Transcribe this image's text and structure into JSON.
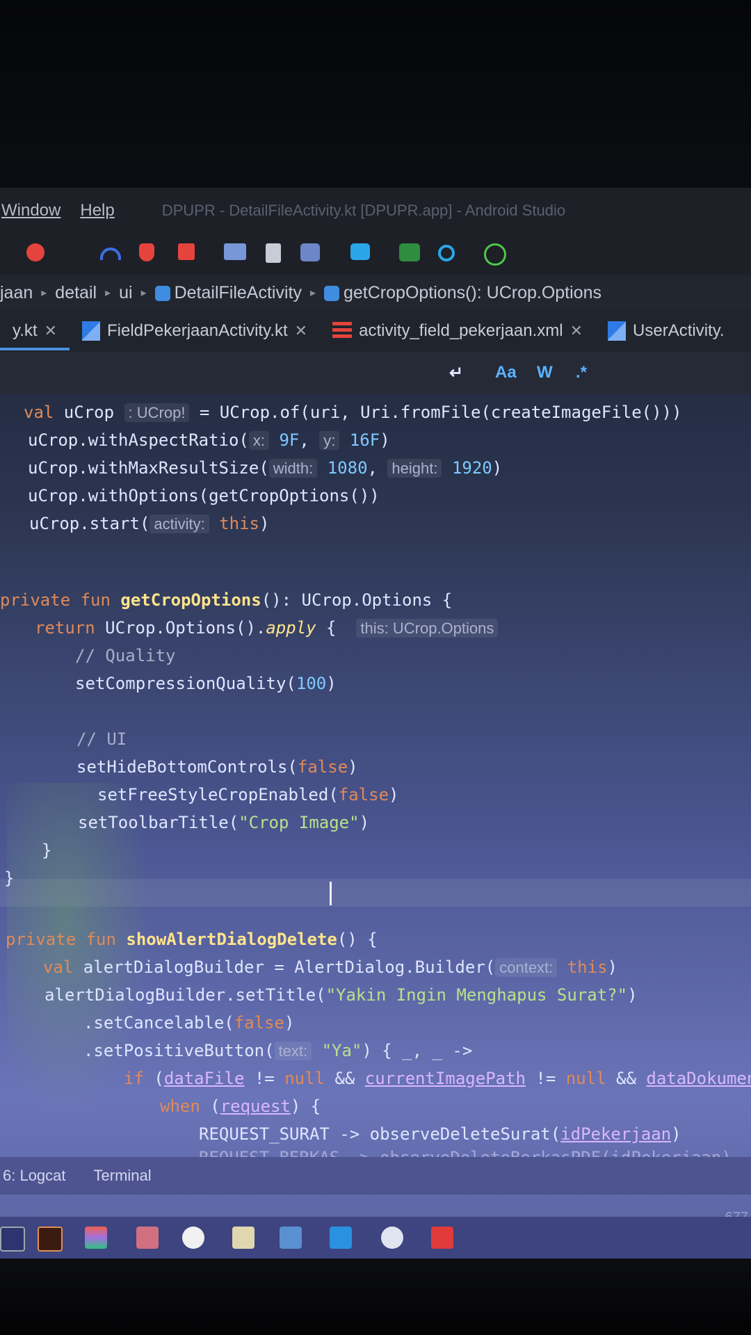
{
  "menu": {
    "items": [
      "Window",
      "Help"
    ],
    "title": "DPUPR - DetailFileActivity.kt [DPUPR.app] - Android Studio"
  },
  "toolbar": {
    "icons": [
      "debug-icon",
      "profiler-icon",
      "apply-changes-icon",
      "stop-icon",
      "attach-debugger-icon",
      "device-manager-icon",
      "sdk-manager-icon",
      "layout-inspector-icon",
      "terminal-icon",
      "search-icon",
      "atom-icon"
    ]
  },
  "breadcrumb": {
    "items": [
      "jaan",
      "detail",
      "ui",
      "DetailFileActivity",
      "getCropOptions(): UCrop.Options"
    ]
  },
  "tabs": [
    {
      "label": "y.kt"
    },
    {
      "label": "FieldPekerjaanActivity.kt"
    },
    {
      "label": "activity_field_pekerjaan.xml"
    },
    {
      "label": "UserActivity."
    }
  ],
  "editor_toolbar": {
    "return_symbol": "↵",
    "match_case": "Aa",
    "words": "W",
    "regex": ".*"
  },
  "code": {
    "l1": {
      "kw": "val",
      "name": " uCrop ",
      "hint": ": UCrop!",
      "rest": " = UCrop.of(uri, Uri.fromFile(createImageFile()))"
    },
    "l2": {
      "a": "uCrop.withAspectRatio(",
      "h1": "x:",
      "v1": "9F",
      "h2": "y:",
      "v2": "16F",
      "b": ")"
    },
    "l3": {
      "a": "uCrop.withMaxResultSize(",
      "h1": "width:",
      "v1": "1080",
      "h2": "height:",
      "v2": "1920",
      "b": ")"
    },
    "l4": "uCrop.withOptions(getCropOptions())",
    "l5": {
      "a": "uCrop.start(",
      "h1": "activity:",
      "kw": "this",
      "b": ")"
    },
    "l6": {
      "kw": "private fun",
      "fn": " getCropOptions",
      "rest": "(): UCrop.Options {"
    },
    "l7": {
      "kw": "return",
      "a": " UCrop.Options().",
      "ital": "apply",
      "b": " {",
      "hint": "this: UCrop.Options"
    },
    "l8": "// Quality",
    "l9": {
      "a": "setCompressionQuality(",
      "v": "100",
      "b": ")"
    },
    "l10": "// UI",
    "l11": {
      "a": "setHideBottomControls(",
      "kw": "false",
      "b": ")"
    },
    "l12": {
      "a": "setFreeStyleCropEnabled(",
      "kw": "false",
      "b": ")"
    },
    "l13": {
      "a": "setToolbarTitle(",
      "s": "\"Crop Image\"",
      "b": ")"
    },
    "l14": "}",
    "l15": "}",
    "l16": {
      "kw": "private fun",
      "fn": " showAlertDialogDelete",
      "rest": "() {"
    },
    "l17": {
      "kw": "val",
      "a": " alertDialogBuilder = AlertDialog.Builder(",
      "h": "context:",
      "kw2": "this",
      "b": ")"
    },
    "l18": {
      "a": "alertDialogBuilder.setTitle(",
      "s": "\"Yakin Ingin Menghapus Surat?\"",
      "b": ")"
    },
    "l19": {
      "a": ".setCancelable(",
      "kw": "false",
      "b": ")"
    },
    "l20": {
      "a": ".setPositiveButton(",
      "h": "text:",
      "s": "\"Ya\"",
      "b": ") { _, _ ->"
    },
    "l21": {
      "kw": "if",
      "a": " (",
      "p1": "dataFile",
      "b": " != ",
      "n1": "null",
      "c": " && ",
      "p2": "currentImagePath",
      "d": " != ",
      "n2": "null",
      "e": " && ",
      "p3": "dataDokumenta"
    },
    "l22": {
      "kw": "when",
      "a": " (",
      "p": "request",
      "b": ") {"
    },
    "l23": {
      "a": "REQUEST_SURAT -> observeDeleteSurat(",
      "p": "idPekerjaan",
      "b": ")"
    },
    "l24": "REQUEST_BERKAS -> observeDeleteBerkasPDF(idPekerjaan)"
  },
  "status": {
    "logcat": "6: Logcat",
    "terminal": "Terminal",
    "right": "677"
  },
  "taskbar": {
    "icons": [
      "start-icon",
      "illustrator-icon",
      "figma-icon",
      "app-icon",
      "chrome-icon",
      "explorer-icon",
      "android-studio-icon",
      "vscode-icon",
      "browser-icon",
      "acrobat-icon"
    ]
  }
}
